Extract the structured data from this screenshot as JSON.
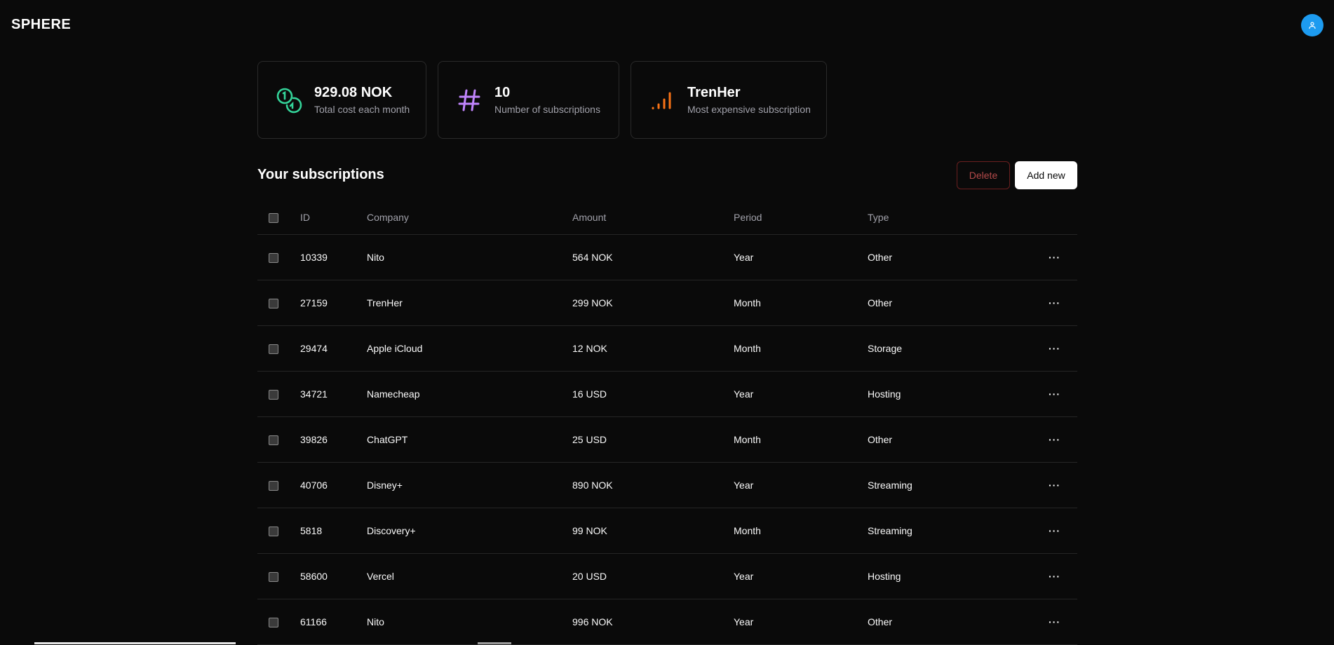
{
  "app": {
    "logo": "SPHERE",
    "avatar_icon": "user-icon"
  },
  "stats": [
    {
      "value": "929.08 NOK",
      "label": "Total cost each month",
      "icon": "coins-icon",
      "color": "#34d399"
    },
    {
      "value": "10",
      "label": "Number of subscriptions",
      "icon": "hash-icon",
      "color": "#c084fc"
    },
    {
      "value": "TrenHer",
      "label": "Most expensive subscription",
      "icon": "signal-bars-icon",
      "color": "#f97316"
    }
  ],
  "section": {
    "title": "Your subscriptions",
    "delete_label": "Delete",
    "add_label": "Add new"
  },
  "table": {
    "columns": [
      "ID",
      "Company",
      "Amount",
      "Period",
      "Type"
    ],
    "rows": [
      {
        "id": "10339",
        "company": "Nito",
        "amount": "564 NOK",
        "period": "Year",
        "type": "Other"
      },
      {
        "id": "27159",
        "company": "TrenHer",
        "amount": "299 NOK",
        "period": "Month",
        "type": "Other"
      },
      {
        "id": "29474",
        "company": "Apple iCloud",
        "amount": "12 NOK",
        "period": "Month",
        "type": "Storage"
      },
      {
        "id": "34721",
        "company": "Namecheap",
        "amount": "16 USD",
        "period": "Year",
        "type": "Hosting"
      },
      {
        "id": "39826",
        "company": "ChatGPT",
        "amount": "25 USD",
        "period": "Month",
        "type": "Other"
      },
      {
        "id": "40706",
        "company": "Disney+",
        "amount": "890 NOK",
        "period": "Year",
        "type": "Streaming"
      },
      {
        "id": "5818",
        "company": "Discovery+",
        "amount": "99 NOK",
        "period": "Month",
        "type": "Streaming"
      },
      {
        "id": "58600",
        "company": "Vercel",
        "amount": "20 USD",
        "period": "Year",
        "type": "Hosting"
      },
      {
        "id": "61166",
        "company": "Nito",
        "amount": "996 NOK",
        "period": "Year",
        "type": "Other"
      }
    ],
    "row_action": "···"
  },
  "colors": {
    "background": "#0a0a0a",
    "avatar": "#1d9bf0",
    "delete_border": "#6b1f1f",
    "delete_text": "#b44a4a"
  }
}
